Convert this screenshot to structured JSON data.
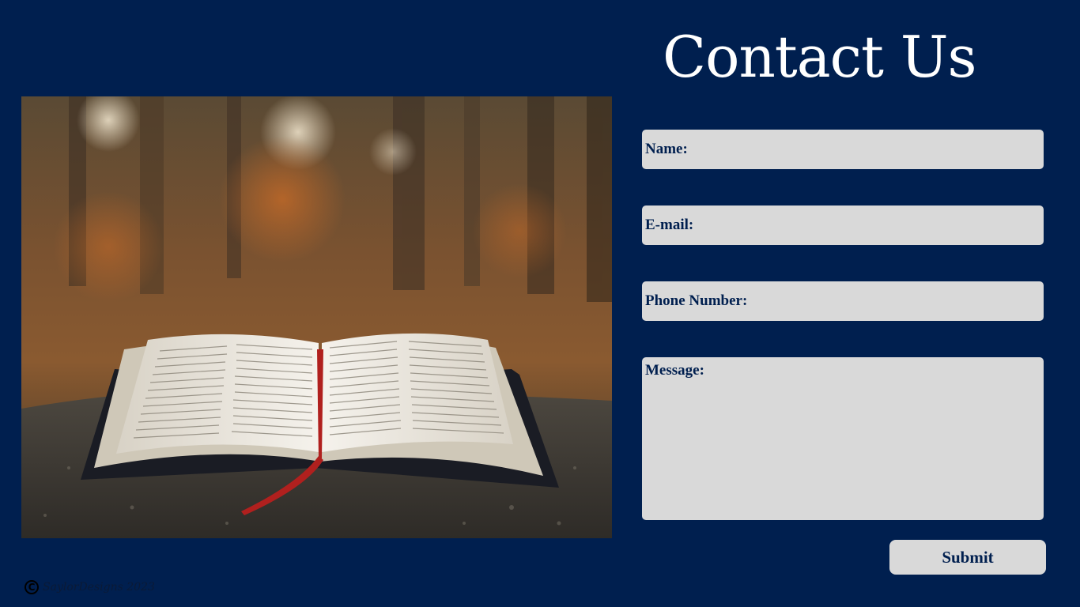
{
  "page": {
    "title": "Contact Us",
    "background_color": "#001f4f"
  },
  "photo": {
    "subject": "open-bible-on-rock-autumn-forest"
  },
  "form": {
    "fields": [
      {
        "label": "Name:"
      },
      {
        "label": "E-mail:"
      },
      {
        "label": "Phone Number:"
      },
      {
        "label": "Message:"
      }
    ],
    "submit_label": "Submit",
    "field_color": "#d9d9d9",
    "label_color": "#001f4f"
  },
  "footer": {
    "copyright_icon": "copyright-icon",
    "copyright_symbol": "C",
    "text": "SaylorDesigns 2023"
  }
}
